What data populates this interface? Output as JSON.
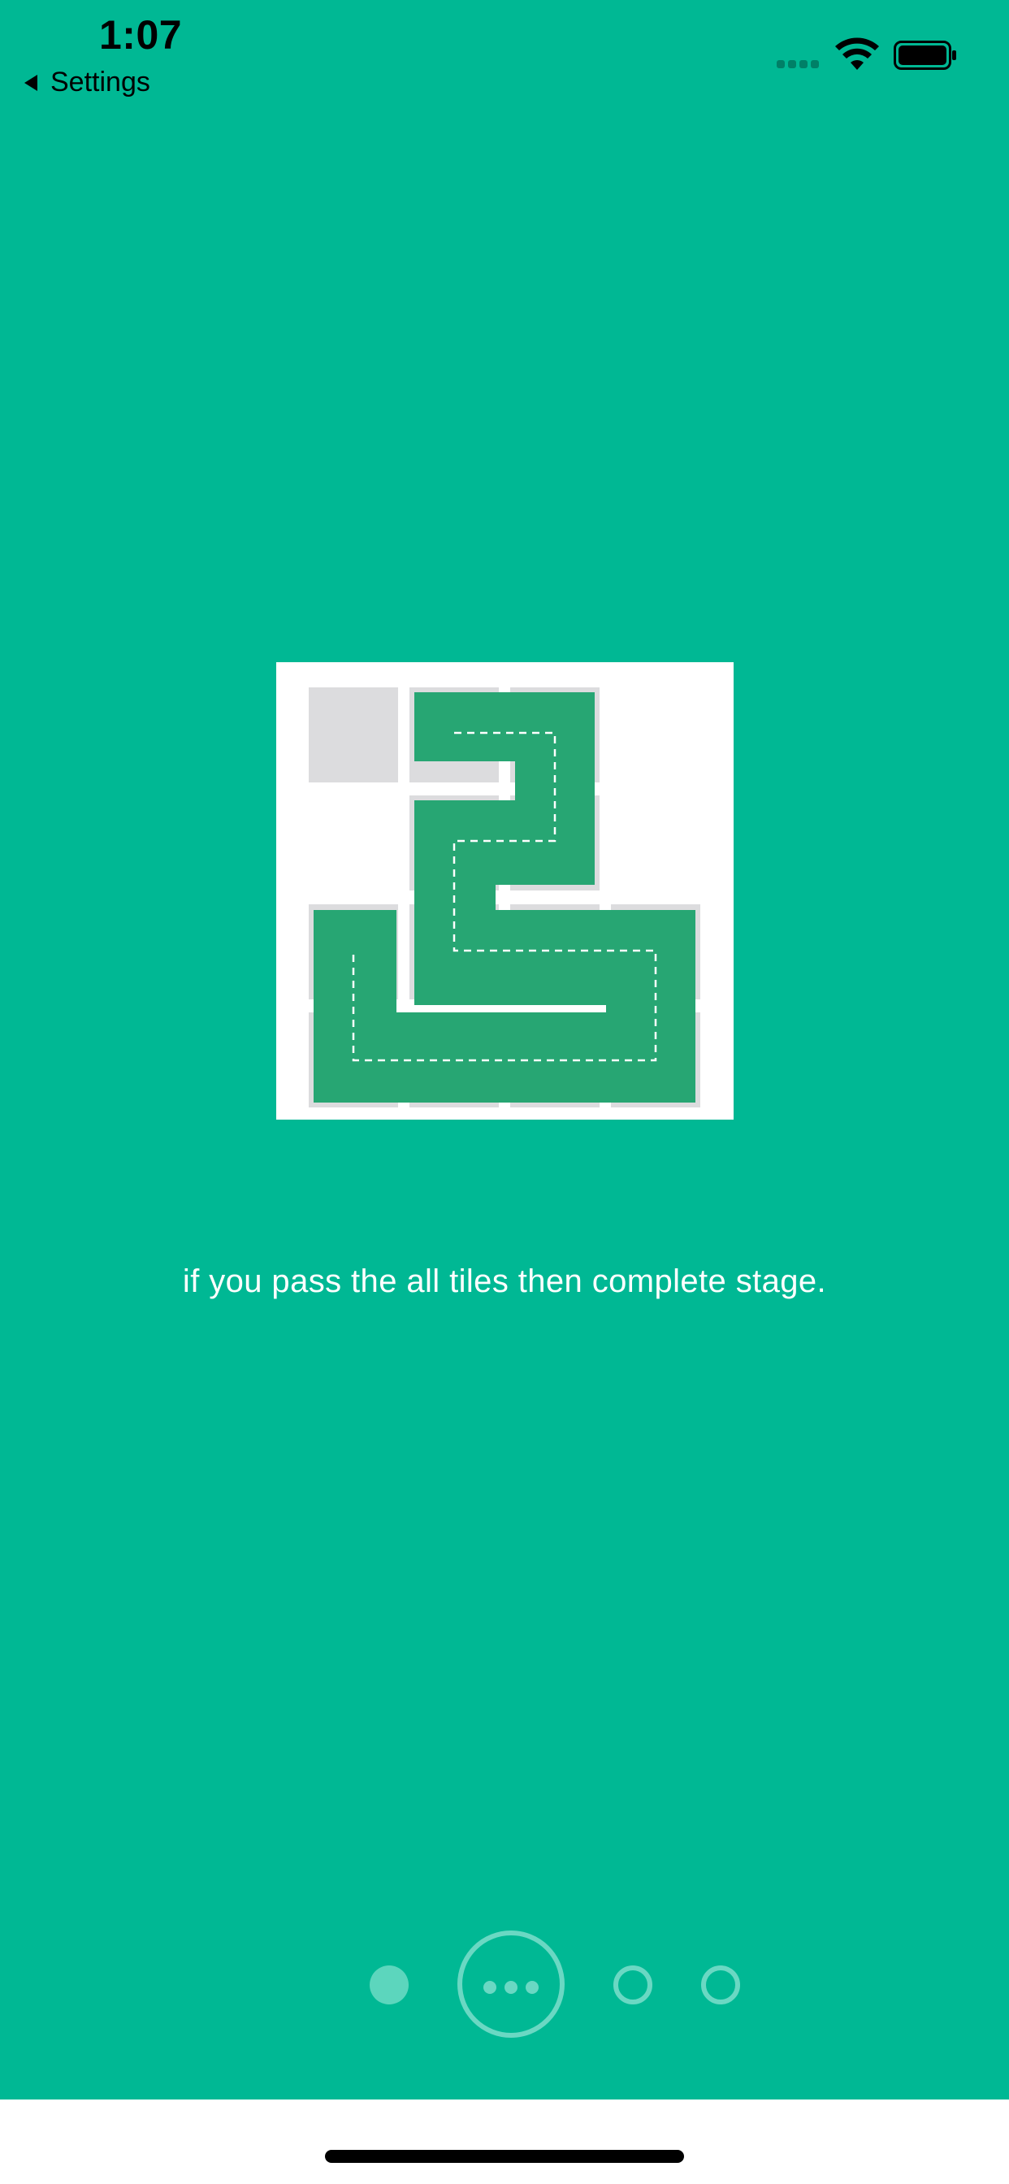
{
  "status_bar": {
    "time": "1:07",
    "back_label": "Settings"
  },
  "tutorial": {
    "image": "tile-path-illustration",
    "description": "if you pass the all tiles then complete stage."
  },
  "pager": {
    "pages": 4,
    "current": 2
  },
  "colors": {
    "background": "#00b894",
    "path_tile": "#27a673",
    "blocked_tile": "#dcdcde",
    "card": "#ffffff"
  }
}
